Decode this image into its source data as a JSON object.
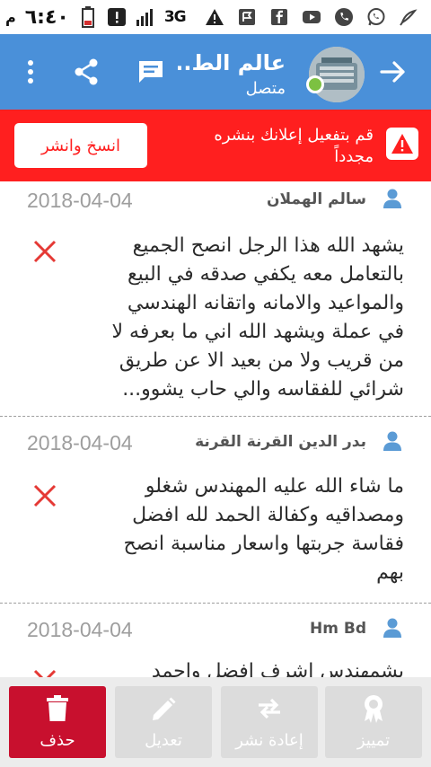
{
  "status_bar": {
    "time": "٦:٤٠",
    "time_suffix": "م",
    "network": "3G",
    "icons": [
      "battery-icon",
      "alert-icon",
      "signal-icon",
      "warning-icon",
      "flag-icon",
      "facebook-icon",
      "youtube-icon",
      "phone-icon",
      "whatsapp-icon",
      "pencil-icon"
    ]
  },
  "header": {
    "title": "عالم الط...",
    "subtitle": "متصل",
    "icons": [
      "back-arrow-icon",
      "chat-icon",
      "share-icon",
      "more-icon"
    ],
    "online_color": "#7cc142"
  },
  "alert": {
    "message": "قم بتفعيل إعلانك بنشره مجدداً",
    "button_label": "انسخ وانشر",
    "color": "#ff1f1f"
  },
  "comments": [
    {
      "author": "سالم الهملان",
      "date": "2018-04-04",
      "text": "يشهد الله هذا الرجل انصح الجميع بالتعامل معه يكفي صدقه في البيع والمواعيد والامانه واتقانه الهندسي في عملة ويشهد الله اني ما بعرفه لا من قريب ولا من بعيد الا عن طريق شرائي للفقاسه والي حاب يشوو..."
    },
    {
      "author": "بدر الدين القرنة القرنة",
      "date": "2018-04-04",
      "text": "ما شاء الله عليه المهندس شغلو ومصداقيه وكفالة الحمد لله افضل فقاسة جربتها واسعار مناسبة انصح بهم"
    },
    {
      "author": "Hm Bd",
      "date": "2018-04-04",
      "text": "بشمهندس اشرف افضل واجمد"
    }
  ],
  "actions": [
    {
      "label": "حذف",
      "icon": "trash-icon"
    },
    {
      "label": "تعديل",
      "icon": "edit-pencil-icon"
    },
    {
      "label": "إعادة نشر",
      "icon": "repost-icon"
    },
    {
      "label": "تمييز",
      "icon": "badge-icon"
    }
  ],
  "colors": {
    "header": "#4a90d9",
    "delete_action": "#c8102e",
    "disabled_action": "#dcdcdc",
    "delete_x": "#e53935"
  }
}
